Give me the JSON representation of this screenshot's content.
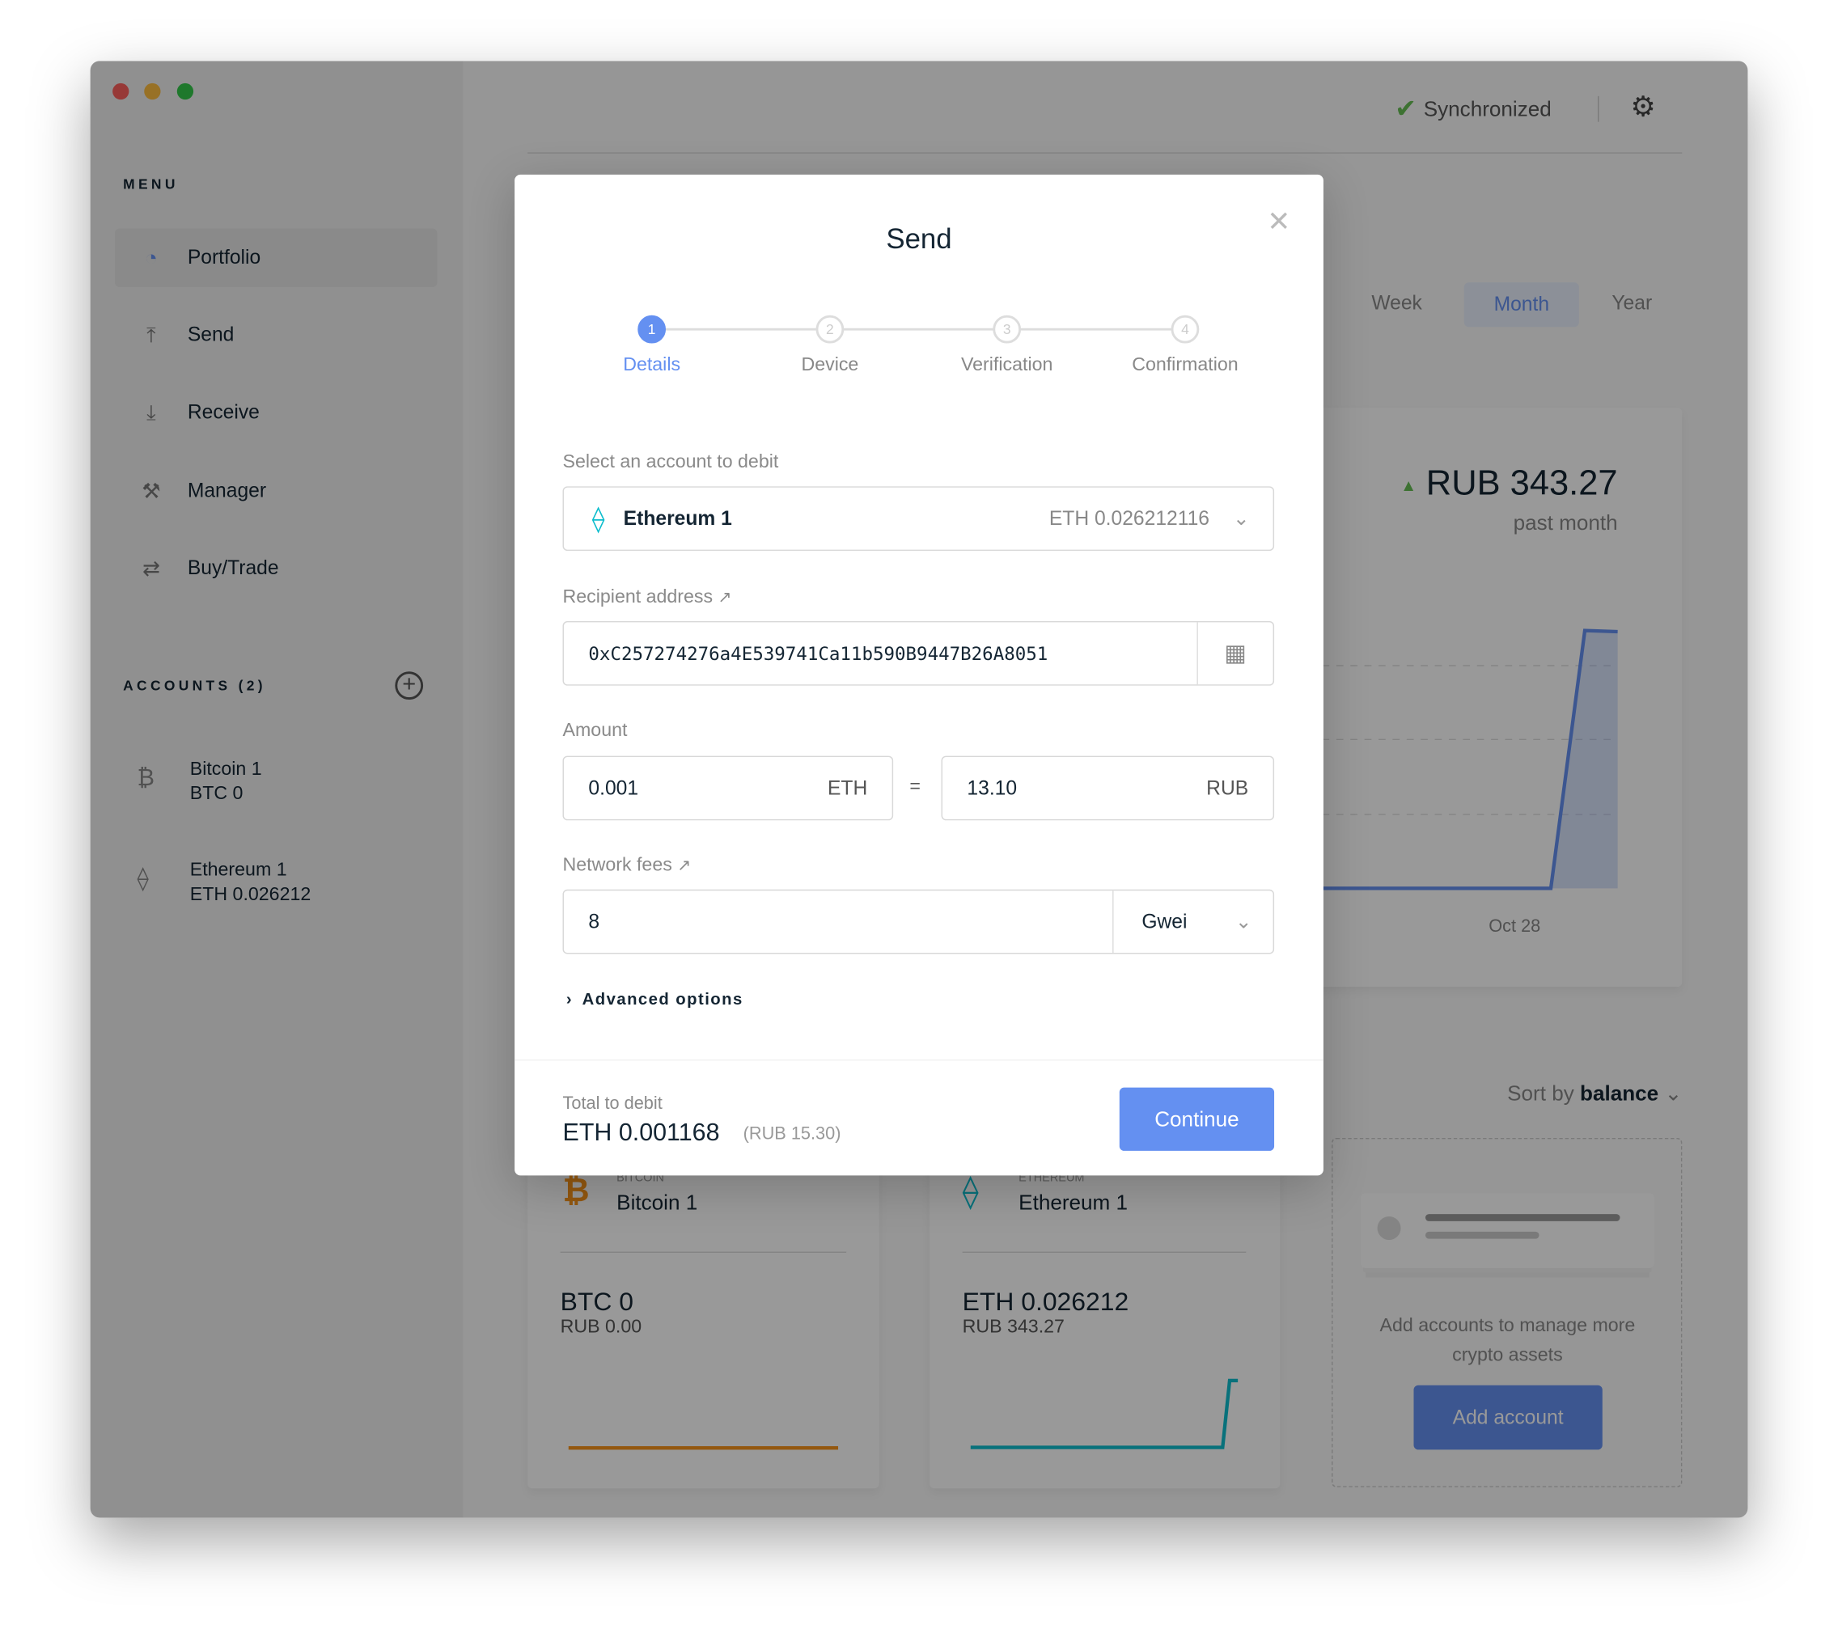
{
  "window": {
    "traffic_lights": [
      "#fc605c",
      "#fdbc40",
      "#34c84a"
    ]
  },
  "sidebar": {
    "menu_title": "MENU",
    "items": [
      {
        "label": "Portfolio",
        "icon": "pie-chart-icon",
        "active": true
      },
      {
        "label": "Send",
        "icon": "arrow-up-icon"
      },
      {
        "label": "Receive",
        "icon": "arrow-down-icon"
      },
      {
        "label": "Manager",
        "icon": "tools-icon"
      },
      {
        "label": "Buy/Trade",
        "icon": "exchange-icon"
      }
    ],
    "accounts_title": "ACCOUNTS (2)",
    "accounts": [
      {
        "name": "Bitcoin 1",
        "balance": "BTC 0",
        "icon": "bitcoin-icon"
      },
      {
        "name": "Ethereum 1",
        "balance": "ETH 0.026212",
        "icon": "ethereum-icon"
      }
    ]
  },
  "topbar": {
    "sync_status": "Synchronized"
  },
  "portfolio": {
    "ranges": [
      "Week",
      "Month",
      "Year"
    ],
    "selected_range": "Month",
    "change": "RUB 343.27",
    "change_period": "past month",
    "x_tick": "Oct 28",
    "sort_label": "Sort by",
    "sort_value": "balance",
    "cards": [
      {
        "currency": "BITCOIN",
        "name": "Bitcoin 1",
        "balance": "BTC 0",
        "fiat": "RUB 0.00",
        "color": "#f7931a"
      },
      {
        "currency": "ETHEREUM",
        "name": "Ethereum 1",
        "balance": "ETH 0.026212",
        "fiat": "RUB 343.27",
        "color": "#0ebdcd"
      }
    ],
    "add_text": "Add accounts to manage more crypto assets",
    "add_button": "Add account"
  },
  "modal": {
    "title": "Send",
    "steps": [
      "Details",
      "Device",
      "Verification",
      "Confirmation"
    ],
    "step_numbers": [
      "1",
      "2",
      "3",
      "4"
    ],
    "current_step": 1,
    "account_label": "Select an account to debit",
    "account_name": "Ethereum 1",
    "account_balance": "ETH 0.026212116",
    "recipient_label": "Recipient address",
    "recipient_value": "0xC257274276a4E539741Ca11b590B9447B26A8051",
    "amount_label": "Amount",
    "amount_value": "0.001",
    "amount_unit": "ETH",
    "equals": "=",
    "fiat_value": "13.10",
    "fiat_unit": "RUB",
    "fees_label": "Network fees",
    "fees_value": "8",
    "fees_unit": "Gwei",
    "advanced": "Advanced options",
    "total_label": "Total to debit",
    "total_value": "ETH 0.001168",
    "total_fiat": "(RUB 15.30)",
    "continue": "Continue",
    "accent": "#6490f1"
  }
}
